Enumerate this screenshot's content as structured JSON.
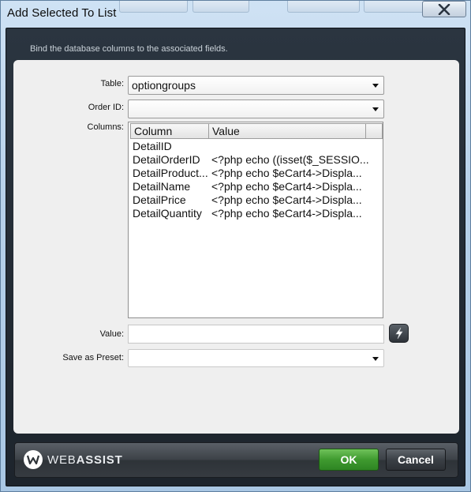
{
  "window": {
    "title": "Add Selected To List",
    "close_icon": "close-icon"
  },
  "dialog": {
    "subtitle": "Bind the database columns to the associated fields."
  },
  "form": {
    "table_label": "Table:",
    "table_value": "optiongroups",
    "order_id_label": "Order ID:",
    "order_id_value": "",
    "columns_label": "Columns:",
    "value_label": "Value:",
    "value_text": "",
    "preset_label": "Save as Preset:",
    "preset_value": ""
  },
  "columns_list": {
    "headers": [
      "Column",
      "Value"
    ],
    "rows": [
      {
        "column": "DetailID",
        "value": ""
      },
      {
        "column": "DetailOrderID",
        "value": "<?php echo ((isset($_SESSIO..."
      },
      {
        "column": "DetailProduct...",
        "value": "<?php echo $eCart4->Displa..."
      },
      {
        "column": "DetailName",
        "value": "<?php echo $eCart4->Displa..."
      },
      {
        "column": "DetailPrice",
        "value": "<?php echo $eCart4->Displa..."
      },
      {
        "column": "DetailQuantity",
        "value": "<?php echo $eCart4->Displa..."
      }
    ]
  },
  "footer": {
    "brand_web": "WEB",
    "brand_assist": "ASSIST",
    "ok_label": "OK",
    "cancel_label": "Cancel"
  },
  "colors": {
    "ok_green": "#3f9a2f",
    "frame_dark": "#1d242c",
    "panel_bg": "#efefef"
  }
}
